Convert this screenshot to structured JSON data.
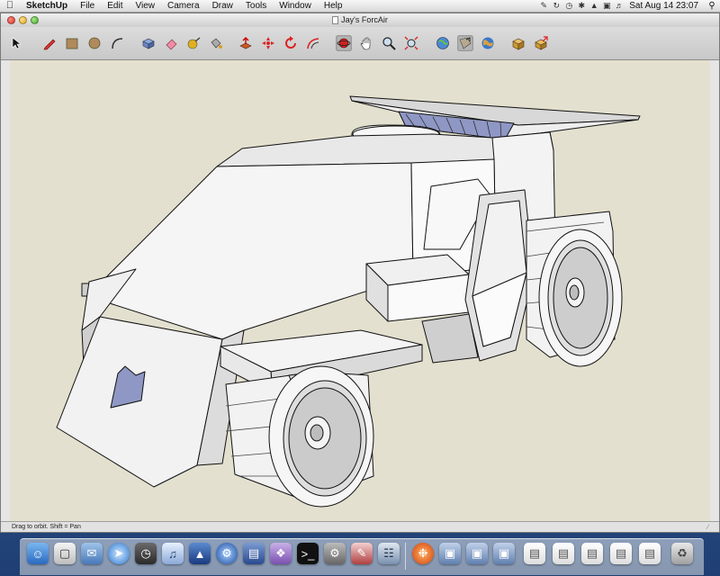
{
  "menubar": {
    "app_name": "SketchUp",
    "items": [
      "File",
      "Edit",
      "View",
      "Camera",
      "Draw",
      "Tools",
      "Window",
      "Help"
    ],
    "clock": "Sat Aug 14  23:07"
  },
  "window": {
    "title": "Jay's ForcAir"
  },
  "toolbar": {
    "tools": [
      {
        "name": "select-tool",
        "icon": "arrow-icon"
      },
      {
        "name": "pencil-tool",
        "icon": "pencil-icon"
      },
      {
        "name": "rectangle-tool",
        "icon": "rectangle-icon"
      },
      {
        "name": "circle-tool",
        "icon": "circle-icon"
      },
      {
        "name": "arc-tool",
        "icon": "arc-icon"
      },
      {
        "name": "make-component-tool",
        "icon": "component-icon"
      },
      {
        "name": "eraser-tool",
        "icon": "eraser-icon"
      },
      {
        "name": "tape-measure-tool",
        "icon": "tape-icon"
      },
      {
        "name": "paint-bucket-tool",
        "icon": "bucket-icon"
      },
      {
        "name": "push-pull-tool",
        "icon": "push-pull-icon"
      },
      {
        "name": "move-tool",
        "icon": "move-icon"
      },
      {
        "name": "rotate-tool",
        "icon": "rotate-icon"
      },
      {
        "name": "offset-tool",
        "icon": "offset-icon"
      },
      {
        "name": "orbit-tool",
        "icon": "orbit-icon"
      },
      {
        "name": "pan-tool",
        "icon": "hand-icon"
      },
      {
        "name": "zoom-tool",
        "icon": "magnifier-icon"
      },
      {
        "name": "zoom-extents-tool",
        "icon": "zoom-extents-icon"
      },
      {
        "name": "get-models-tool",
        "icon": "globe-icon"
      },
      {
        "name": "share-model-tool",
        "icon": "share-icon"
      },
      {
        "name": "google-earth-tool",
        "icon": "earth-icon"
      },
      {
        "name": "component-window-tool",
        "icon": "box-icon"
      },
      {
        "name": "extension-tool",
        "icon": "box-arrow-icon"
      }
    ]
  },
  "statusbar": {
    "text": "Drag to orbit.  Shift = Pan"
  },
  "colors": {
    "canvas_bg": "#e3e0cf",
    "model_face": "#f4f4f4",
    "model_shade": "#c9c9c9",
    "model_edge": "#000000",
    "back_face": "#8f97c4"
  },
  "dock": {
    "icons": [
      "finder-icon",
      "preview-icon",
      "mail-icon",
      "safari-icon",
      "dashboard-icon",
      "itunes-icon",
      "iphoto-icon",
      "system-preferences-icon",
      "terminal-icon",
      "activity-monitor-icon",
      "textedit-icon",
      "sketchup-icon",
      "firefox-icon",
      "downloads-icon",
      "documents-icon",
      "window-thumbnail-icon",
      "window-thumbnail-icon",
      "window-thumbnail-icon",
      "window-thumbnail-icon",
      "window-thumbnail-icon",
      "window-thumbnail-icon",
      "trash-icon"
    ]
  }
}
